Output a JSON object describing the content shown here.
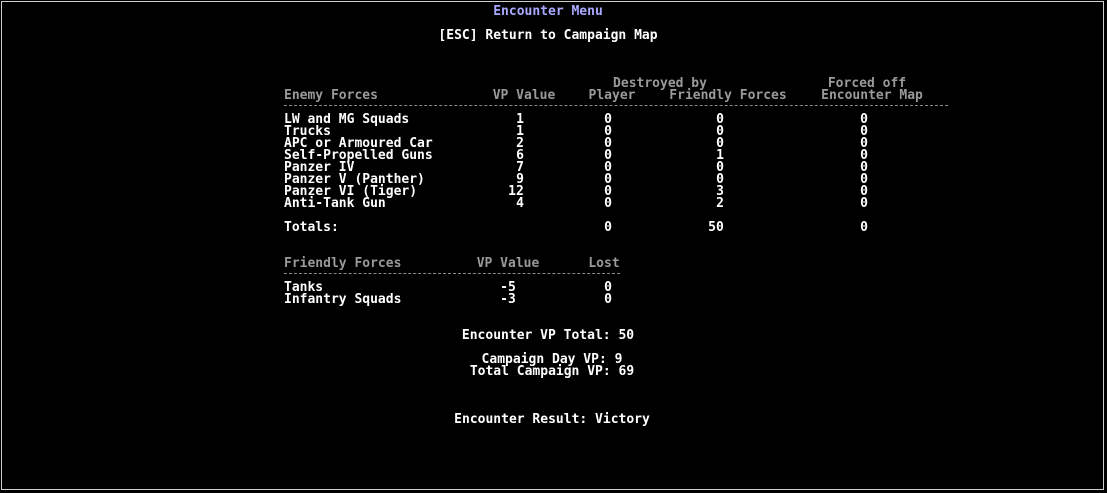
{
  "menu": {
    "title": "Encounter Menu",
    "esc_option": "[ESC] Return to Campaign Map"
  },
  "enemy": {
    "group_header_destroyed": "Destroyed by",
    "group_header_forced": "Forced off",
    "columns": [
      "Enemy Forces",
      "VP Value",
      "Player",
      "Friendly Forces",
      "Encounter Map"
    ],
    "rows": [
      {
        "name": "LW and MG Squads",
        "vp": "1",
        "player": "0",
        "friendly": "0",
        "forced": "0"
      },
      {
        "name": "Trucks",
        "vp": "1",
        "player": "0",
        "friendly": "0",
        "forced": "0"
      },
      {
        "name": "APC or Armoured Car",
        "vp": "2",
        "player": "0",
        "friendly": "0",
        "forced": "0"
      },
      {
        "name": "Self-Propelled Guns",
        "vp": "6",
        "player": "0",
        "friendly": "1",
        "forced": "0"
      },
      {
        "name": "Panzer IV",
        "vp": "7",
        "player": "0",
        "friendly": "0",
        "forced": "0"
      },
      {
        "name": "Panzer V (Panther)",
        "vp": "9",
        "player": "0",
        "friendly": "0",
        "forced": "0"
      },
      {
        "name": "Panzer VI (Tiger)",
        "vp": "12",
        "player": "0",
        "friendly": "3",
        "forced": "0"
      },
      {
        "name": "Anti-Tank Gun",
        "vp": "4",
        "player": "0",
        "friendly": "2",
        "forced": "0"
      }
    ],
    "totals_label": "Totals:",
    "totals": {
      "player": "0",
      "friendly": "50",
      "forced": "0"
    }
  },
  "friendly": {
    "columns": [
      "Friendly Forces",
      "VP Value",
      "Lost"
    ],
    "rows": [
      {
        "name": "Tanks",
        "vp": "-5",
        "lost": "0"
      },
      {
        "name": "Infantry Squads",
        "vp": "-3",
        "lost": "0"
      }
    ]
  },
  "summary": {
    "encounter_vp_total": "Encounter VP Total: 50",
    "campaign_day_vp": "Campaign Day VP: 9",
    "total_campaign_vp": "Total Campaign VP: 69",
    "encounter_result": "Encounter Result: Victory"
  },
  "colors": {
    "background": "#000000",
    "text": "#ffffff",
    "header": "#9a9a9a",
    "title": "#a9a9ff"
  }
}
